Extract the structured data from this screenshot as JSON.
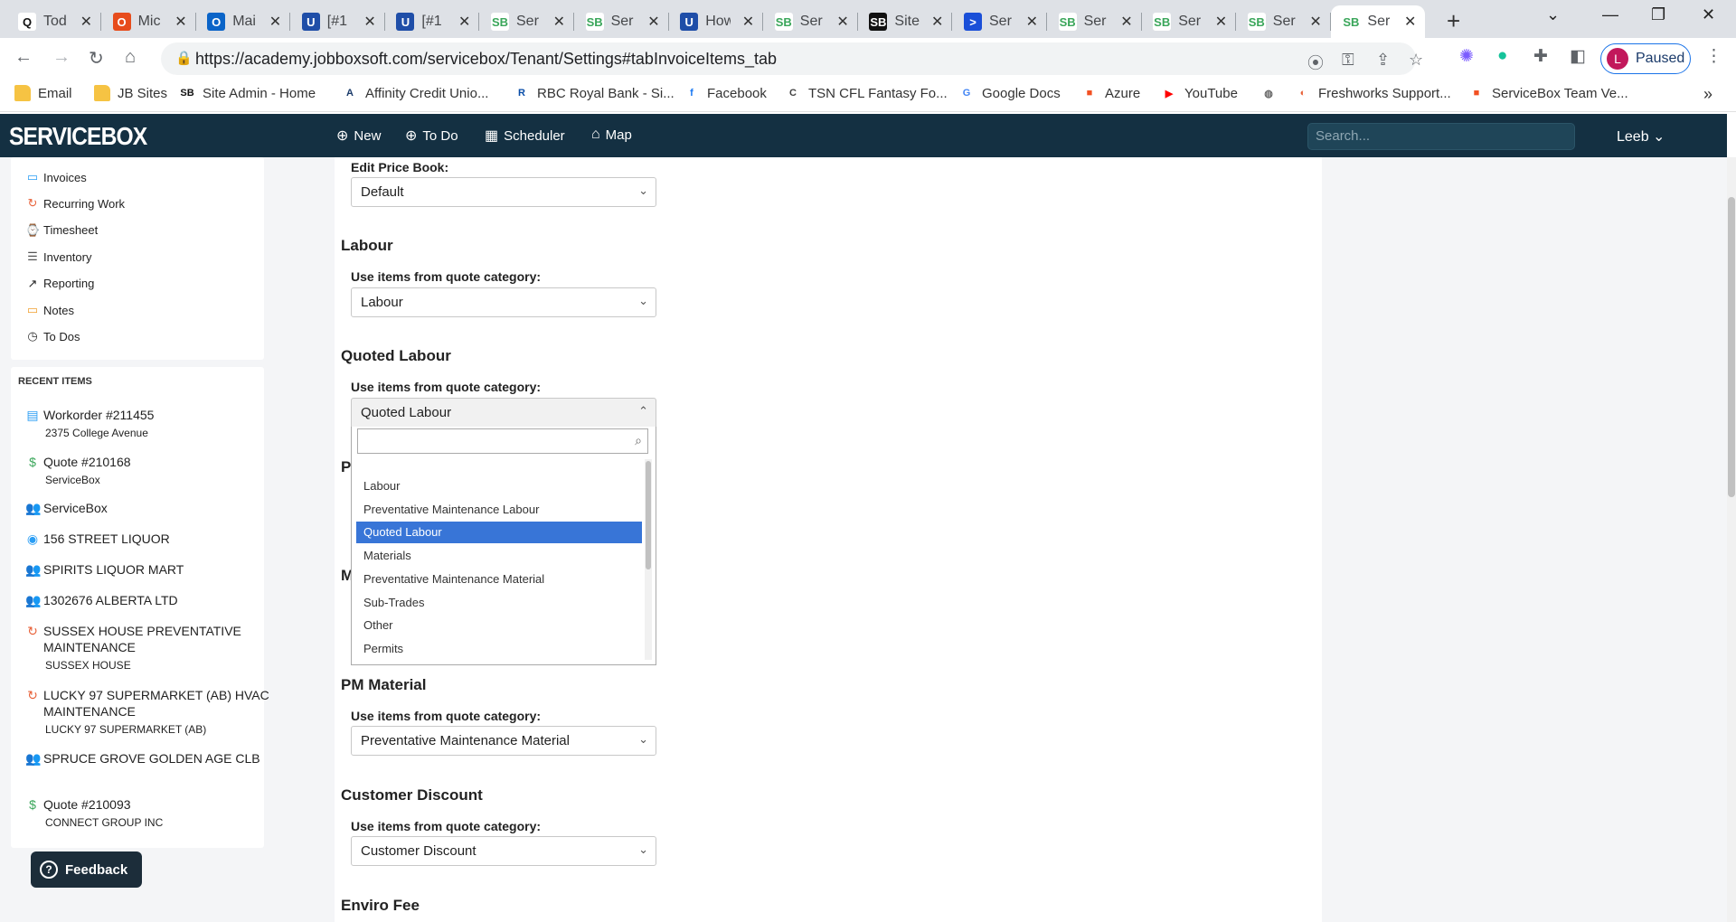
{
  "browser": {
    "tabs": [
      {
        "label": "Tod",
        "icon": "Q",
        "bg": "#ffffff",
        "fg": "#111"
      },
      {
        "label": "Mic",
        "icon": "O",
        "bg": "#e74c1c",
        "fg": "#fff"
      },
      {
        "label": "Mai",
        "icon": "O",
        "bg": "#0a64c8",
        "fg": "#fff"
      },
      {
        "label": "[#1",
        "icon": "U",
        "bg": "#1f4ea8",
        "fg": "#fff"
      },
      {
        "label": "[#1",
        "icon": "U",
        "bg": "#1f4ea8",
        "fg": "#fff"
      },
      {
        "label": "Ser",
        "icon": "SB",
        "bg": "#ffffff",
        "fg": "#3aa65a"
      },
      {
        "label": "Ser",
        "icon": "SB",
        "bg": "#ffffff",
        "fg": "#3aa65a"
      },
      {
        "label": "How",
        "icon": "U",
        "bg": "#1f4ea8",
        "fg": "#fff"
      },
      {
        "label": "Ser",
        "icon": "SB",
        "bg": "#ffffff",
        "fg": "#3aa65a"
      },
      {
        "label": "Site",
        "icon": "SB",
        "bg": "#111111",
        "fg": "#fff"
      },
      {
        "label": "Ser",
        "icon": ">",
        "bg": "#1a4fd8",
        "fg": "#fff"
      },
      {
        "label": "Ser",
        "icon": "SB",
        "bg": "#ffffff",
        "fg": "#3aa65a"
      },
      {
        "label": "Ser",
        "icon": "SB",
        "bg": "#ffffff",
        "fg": "#3aa65a"
      },
      {
        "label": "Ser",
        "icon": "SB",
        "bg": "#ffffff",
        "fg": "#3aa65a"
      },
      {
        "label": "Ser",
        "icon": "SB",
        "bg": "#ffffff",
        "fg": "#3aa65a",
        "active": true
      }
    ],
    "url": "https://academy.jobboxsoft.com/servicebox/Tenant/Settings#tabInvoiceItems_tab",
    "profile_initial": "L",
    "profile_status": "Paused",
    "bookmarks": [
      {
        "label": "Email",
        "icon": "",
        "color": "#f6c343"
      },
      {
        "label": "JB Sites",
        "icon": "",
        "color": "#f6c343"
      },
      {
        "label": "Site Admin - Home",
        "icon": "SB",
        "color": "#111"
      },
      {
        "label": "Affinity Credit Unio...",
        "icon": "A",
        "color": "#1a3a6a"
      },
      {
        "label": "RBC Royal Bank - Si...",
        "icon": "R",
        "color": "#0a4ea8"
      },
      {
        "label": "Facebook",
        "icon": "f",
        "color": "#1877f2"
      },
      {
        "label": "TSN CFL Fantasy Fo...",
        "icon": "C",
        "color": "#444"
      },
      {
        "label": "Google Docs",
        "icon": "G",
        "color": "#4285f4"
      },
      {
        "label": "Azure",
        "icon": "■",
        "color": "#f25022"
      },
      {
        "label": "YouTube",
        "icon": "▶",
        "color": "#ff0000"
      },
      {
        "label": "",
        "icon": "◍",
        "color": "#666"
      },
      {
        "label": "Freshworks Support...",
        "icon": "◐",
        "color": "#e8623a"
      },
      {
        "label": "ServiceBox Team Ve...",
        "icon": "■",
        "color": "#f25022"
      }
    ]
  },
  "app": {
    "logo": "SERVICEBOX",
    "nav": [
      {
        "label": "New",
        "icon": "⊕"
      },
      {
        "label": "To Do",
        "icon": "⊕"
      },
      {
        "label": "Scheduler",
        "icon": "▦"
      },
      {
        "label": "Map",
        "icon": "⌂"
      }
    ],
    "search_placeholder": "Search...",
    "user": "Leeb"
  },
  "sidebar": {
    "items": [
      {
        "label": "Invoices",
        "icon": "▭",
        "color": "#2a9df4"
      },
      {
        "label": "Recurring Work",
        "icon": "↻",
        "color": "#e8623a"
      },
      {
        "label": "Timesheet",
        "icon": "⌚",
        "color": "#555"
      },
      {
        "label": "Inventory",
        "icon": "☰",
        "color": "#555"
      },
      {
        "label": "Reporting",
        "icon": "↗",
        "color": "#222"
      },
      {
        "label": "Notes",
        "icon": "▭",
        "color": "#f0a030"
      },
      {
        "label": "To Dos",
        "icon": "◷",
        "color": "#333"
      }
    ],
    "recent_title": "RECENT ITEMS",
    "recent": [
      {
        "title": "Workorder #211455",
        "sub": "2375 College Avenue",
        "icon": "▤",
        "color": "#2a9df4"
      },
      {
        "title": "Quote #210168",
        "sub": "ServiceBox",
        "icon": "$",
        "color": "#3aa65a"
      },
      {
        "title": "ServiceBox",
        "sub": "",
        "icon": "👥",
        "color": "#333"
      },
      {
        "title": "156 STREET LIQUOR",
        "sub": "",
        "icon": "◉",
        "color": "#2a9df4"
      },
      {
        "title": "SPIRITS LIQUOR MART",
        "sub": "",
        "icon": "👥",
        "color": "#333"
      },
      {
        "title": "1302676 ALBERTA LTD",
        "sub": "",
        "icon": "👥",
        "color": "#333"
      },
      {
        "title": "SUSSEX HOUSE PREVENTATIVE MAINTENANCE",
        "sub": "SUSSEX HOUSE",
        "icon": "↻",
        "color": "#e8623a"
      },
      {
        "title": "LUCKY 97 SUPERMARKET (AB) HVAC MAINTENANCE",
        "sub": "LUCKY 97 SUPERMARKET (AB)",
        "icon": "↻",
        "color": "#e8623a"
      },
      {
        "title": "SPRUCE GROVE GOLDEN AGE CLB",
        "sub": "",
        "icon": "👥",
        "color": "#333"
      },
      {
        "title": "Quote #210093",
        "sub": "CONNECT GROUP INC",
        "icon": "$",
        "color": "#3aa65a"
      }
    ],
    "feedback": "Feedback"
  },
  "settings": {
    "price_book_label": "Edit Price Book:",
    "price_book_value": "Default",
    "use_items_label": "Use items from quote category:",
    "sections": [
      {
        "title": "Labour",
        "value": "Labour"
      },
      {
        "title": "Quoted Labour",
        "value": "Quoted Labour"
      },
      {
        "title": "PM Material",
        "value": "Preventative Maintenance Material"
      },
      {
        "title": "Customer Discount",
        "value": "Customer Discount"
      }
    ],
    "last_section_title": "Enviro Fee",
    "hidden_sections": [
      "P",
      "M"
    ]
  },
  "dropdown": {
    "search_value": "",
    "options": [
      "Labour",
      "Preventative Maintenance Labour",
      "Quoted Labour",
      "Materials",
      "Preventative Maintenance Material",
      "Sub-Trades",
      "Other",
      "Permits"
    ],
    "selected": "Quoted Labour"
  }
}
